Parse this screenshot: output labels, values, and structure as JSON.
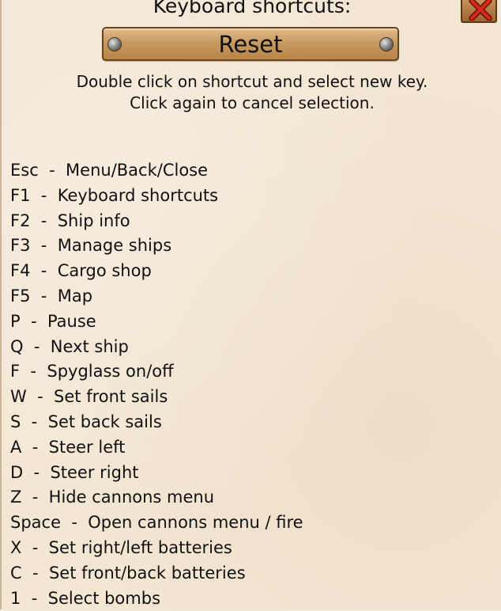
{
  "title": "Keyboard shortcuts:",
  "reset_label": "Reset",
  "hint_line1": "Double click on shortcut and select new key.",
  "hint_line2": "Click again to cancel selection.",
  "close_icon": "close-x-icon",
  "shortcuts": [
    "Esc  -  Menu/Back/Close",
    "F1  -  Keyboard shortcuts",
    "F2  -  Ship info",
    "F3  -  Manage ships",
    "F4  -  Cargo shop",
    "F5  -  Map",
    "P  -  Pause",
    "Q  -  Next ship",
    "F  -  Spyglass on/off",
    "W  -  Set front sails",
    "S  -  Set back sails",
    "A  -  Steer left",
    "D  -  Steer right",
    "Z  -  Hide cannons menu",
    "Space  -  Open cannons menu / fire",
    "X  -  Set right/left batteries",
    "C  -  Set front/back batteries",
    "1  -  Select bombs"
  ]
}
